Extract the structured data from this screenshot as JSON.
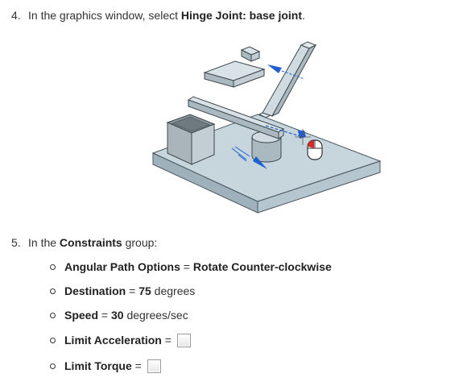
{
  "step4": {
    "number": "4.",
    "text": "In the graphics window, select ",
    "bold": "Hinge Joint: base joint",
    "end": "."
  },
  "step5": {
    "number": "5.",
    "text": "In the ",
    "bold": "Constraints",
    "end": " group:"
  },
  "options": [
    {
      "label": "Angular Path Options",
      "eq": " = ",
      "value": "Rotate Counter-clockwise",
      "unit": ""
    },
    {
      "label": "Destination",
      "eq": " = ",
      "value": "75",
      "unit": " degrees"
    },
    {
      "label": "Speed",
      "eq": " = ",
      "value": "30",
      "unit": " degrees/sec"
    },
    {
      "label": "Limit Acceleration",
      "eq": " = ",
      "checked": false
    },
    {
      "label": "Limit Torque",
      "eq": " = ",
      "checked": false
    }
  ],
  "colors": {
    "text": "#333333",
    "part_face": "#cdd9df",
    "part_edge": "#4a5660",
    "arrow_blue": "#1f5fd0"
  }
}
